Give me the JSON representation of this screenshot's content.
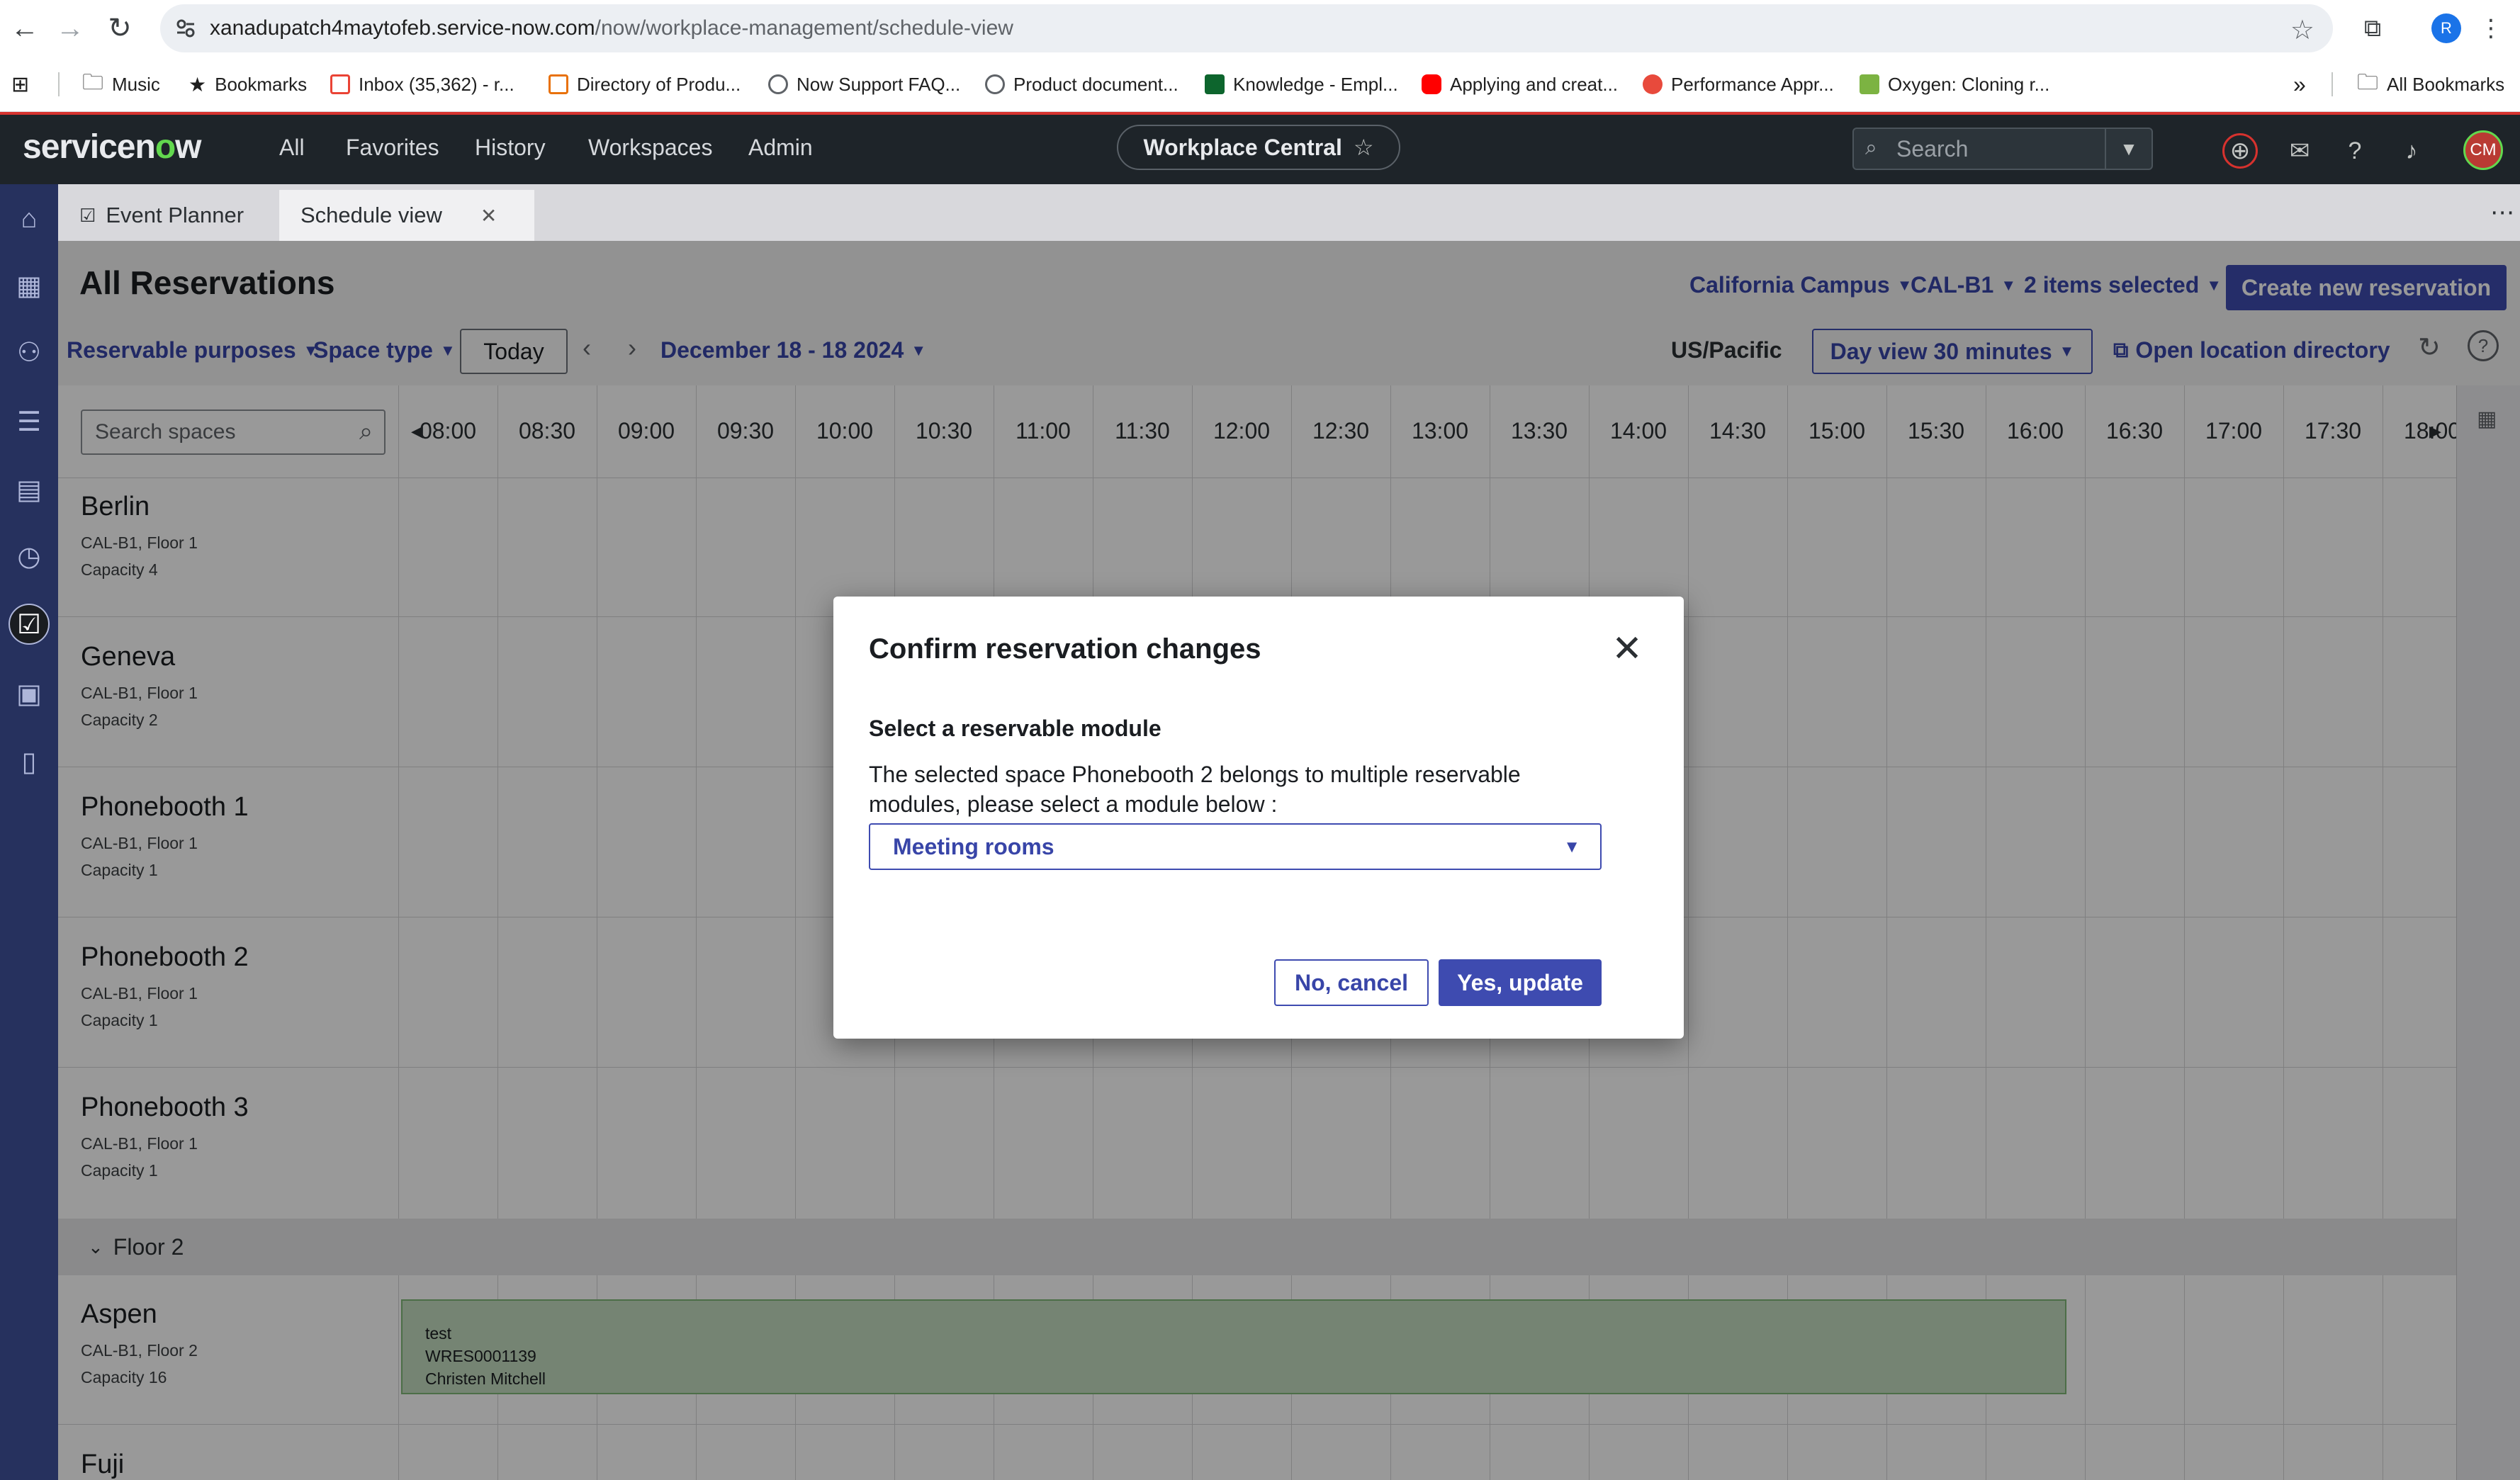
{
  "browser": {
    "url_host": "xanadupatch4maytofeb.service-now.com",
    "url_path": "/now/workplace-management/schedule-view",
    "profile_initial": "R",
    "bookmarks": [
      {
        "label": "Music"
      },
      {
        "label": "Bookmarks"
      },
      {
        "label": "Inbox (35,362) - r..."
      },
      {
        "label": "Directory of Produ..."
      },
      {
        "label": "Now Support FAQ..."
      },
      {
        "label": "Product document..."
      },
      {
        "label": "Knowledge - Empl..."
      },
      {
        "label": "Applying and creat..."
      },
      {
        "label": "Performance Appr..."
      },
      {
        "label": "Oxygen: Cloning r..."
      }
    ],
    "more_label": "»",
    "all_bookmarks": "All Bookmarks"
  },
  "header": {
    "logo_pre": "servicen",
    "logo_o": "o",
    "logo_post": "w",
    "nav": [
      "All",
      "Favorites",
      "History",
      "Workspaces",
      "Admin"
    ],
    "workspace_name": "Workplace Central",
    "search_placeholder": "Search",
    "avatar_initials": "CM"
  },
  "tabs": [
    {
      "label": "Event Planner"
    },
    {
      "label": "Schedule view"
    }
  ],
  "page": {
    "title": "All Reservations",
    "campus": "California Campus",
    "building": "CAL-B1",
    "items_selected": "2 items selected",
    "create_button": "Create new reservation",
    "reservable_purposes": "Reservable purposes",
    "space_type": "Space type",
    "today": "Today",
    "date_range": "December 18 - 18 2024",
    "timezone": "US/Pacific",
    "day_view": "Day view 30 minutes",
    "open_directory": "Open location directory"
  },
  "grid": {
    "search_placeholder": "Search spaces",
    "times": [
      "08:00",
      "08:30",
      "09:00",
      "09:30",
      "10:00",
      "10:30",
      "11:00",
      "11:30",
      "12:00",
      "12:30",
      "13:00",
      "13:30",
      "14:00",
      "14:30",
      "15:00",
      "15:30",
      "16:00",
      "16:30",
      "17:00",
      "17:30",
      "18:00"
    ],
    "rooms": [
      {
        "name": "Berlin",
        "location": "CAL-B1, Floor 1",
        "capacity": "Capacity 4"
      },
      {
        "name": "Geneva",
        "location": "CAL-B1, Floor 1",
        "capacity": "Capacity 2"
      },
      {
        "name": "Phonebooth 1",
        "location": "CAL-B1, Floor 1",
        "capacity": "Capacity 1"
      },
      {
        "name": "Phonebooth 2",
        "location": "CAL-B1, Floor 1",
        "capacity": "Capacity 1"
      },
      {
        "name": "Phonebooth 3",
        "location": "CAL-B1, Floor 1",
        "capacity": "Capacity 1"
      }
    ],
    "floor2_label": "Floor 2",
    "floor2_rooms": [
      {
        "name": "Aspen",
        "location": "CAL-B1, Floor 2",
        "capacity": "Capacity 16"
      },
      {
        "name": "Fuji"
      }
    ],
    "reservation": {
      "title": "test",
      "number": "WRES0001139",
      "person": "Christen Mitchell"
    }
  },
  "modal": {
    "title": "Confirm reservation changes",
    "select_label": "Select a reservable module",
    "description": "The selected space Phonebooth 2 belongs to multiple reservable modules, please select a module below :",
    "selected_module": "Meeting rooms",
    "cancel_label": "No, cancel",
    "confirm_label": "Yes, update"
  },
  "colors": {
    "primary": "#3e4bb0",
    "header_bg": "#1e2429",
    "rail_bg": "#26315e",
    "reservation_bg": "#c4dcc0"
  }
}
